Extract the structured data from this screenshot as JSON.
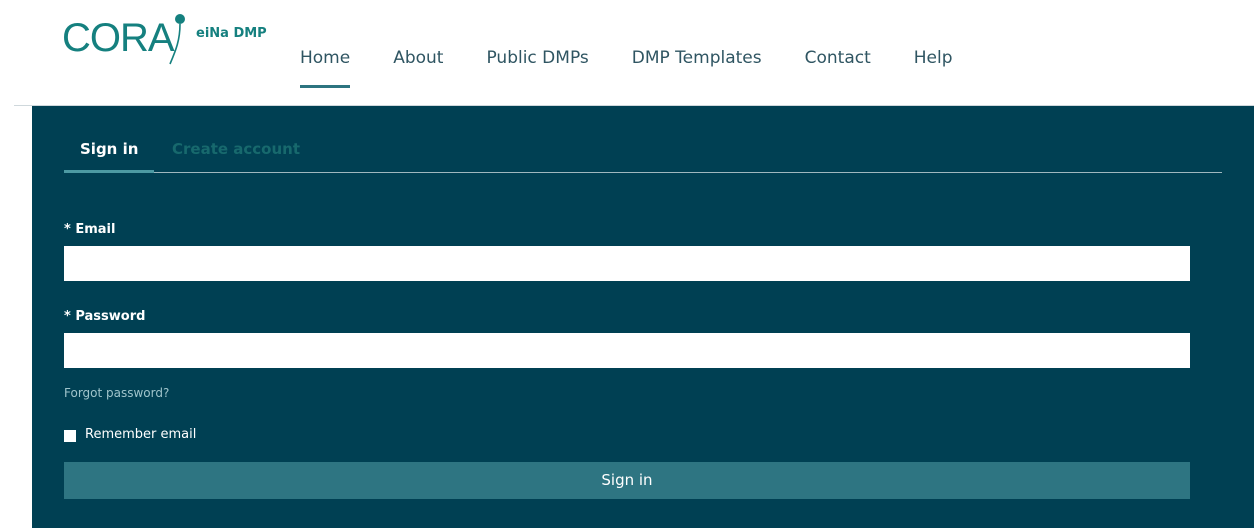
{
  "brand": {
    "logo_text": "CORA",
    "logo_subtext": "eiNa DMP",
    "logo_mark_icon": "pin-drop-icon",
    "color": "#15807f"
  },
  "nav": {
    "items": [
      {
        "label": "Home",
        "active": true
      },
      {
        "label": "About",
        "active": false
      },
      {
        "label": "Public DMPs",
        "active": false
      },
      {
        "label": "DMP Templates",
        "active": false
      },
      {
        "label": "Contact",
        "active": false
      },
      {
        "label": "Help",
        "active": false
      }
    ]
  },
  "auth": {
    "tabs": [
      {
        "label": "Sign in",
        "active": true
      },
      {
        "label": "Create account",
        "active": false
      }
    ],
    "email_label": "* Email",
    "email_value": "",
    "password_label": "* Password",
    "password_value": "",
    "forgot_password": "Forgot password?",
    "remember_label": "Remember email",
    "remember_checked": false,
    "submit_label": "Sign in"
  },
  "colors": {
    "panel_bg": "#004053",
    "button_bg": "#2e7582",
    "accent": "#2d7480"
  }
}
